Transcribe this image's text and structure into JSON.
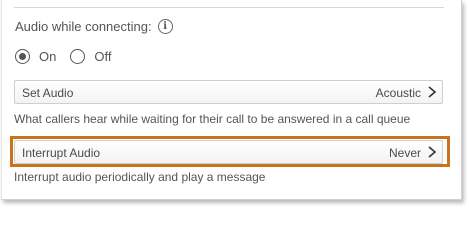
{
  "section": {
    "heading": "Audio while connecting:",
    "info_icon": "info-icon"
  },
  "radio": {
    "options": [
      {
        "label": "On",
        "checked": true
      },
      {
        "label": "Off",
        "checked": false
      }
    ]
  },
  "set_audio": {
    "label": "Set Audio",
    "value": "Acoustic",
    "helper": "What callers hear while waiting for their call to be answered in a call queue"
  },
  "interrupt_audio": {
    "label": "Interrupt Audio",
    "value": "Never",
    "helper": "Interrupt audio periodically and play a message"
  },
  "colors": {
    "highlight": "#c8741f"
  }
}
